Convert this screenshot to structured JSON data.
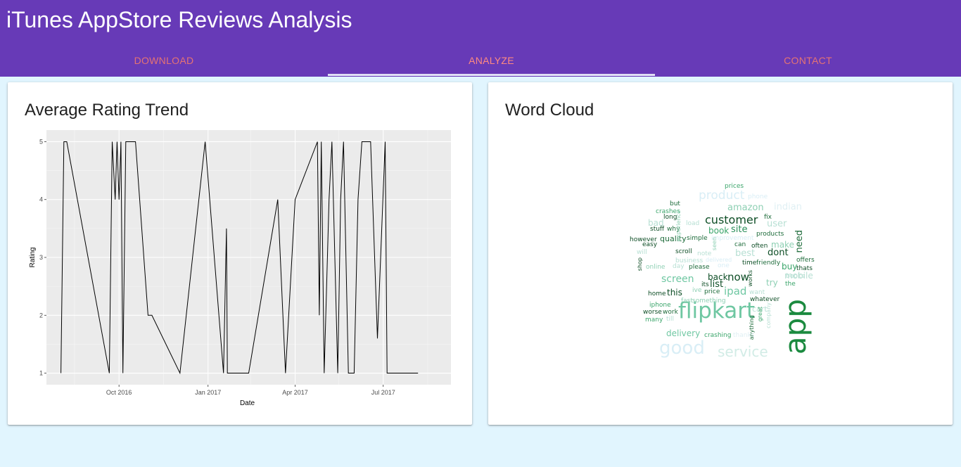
{
  "app": {
    "title": "iTunes AppStore Reviews Analysis"
  },
  "tabs": [
    {
      "label": "DOWNLOAD",
      "active": false
    },
    {
      "label": "ANALYZE",
      "active": true
    },
    {
      "label": "CONTACT",
      "active": false
    }
  ],
  "colors": {
    "appbar": "#673ab7",
    "background": "#e1f5fe",
    "tab_text": "#e57373",
    "line": "#000000",
    "panel": "#ebebeb"
  },
  "trend_card": {
    "title": "Average Rating Trend"
  },
  "wordcloud_card": {
    "title": "Word Cloud"
  },
  "chart_data": {
    "type": "line",
    "title": "",
    "xlabel": "Date",
    "ylabel": "Rating",
    "x_ticks": [
      "Oct 2016",
      "Jan 2017",
      "Apr 2017",
      "Jul 2017"
    ],
    "y_ticks": [
      1,
      2,
      3,
      4,
      5
    ],
    "ylim": [
      0.8,
      5.2
    ],
    "xlim": [
      "2016-07-18",
      "2017-09-09"
    ],
    "grid": true,
    "series": [
      {
        "x": [
          "2016-08-02",
          "2016-08-05",
          "2016-08-08",
          "2016-09-21",
          "2016-09-24",
          "2016-09-27",
          "2016-09-29",
          "2016-10-01",
          "2016-10-03",
          "2016-10-05",
          "2016-10-08",
          "2016-10-10",
          "2016-10-13",
          "2016-10-18",
          "2016-10-31",
          "2016-11-04",
          "2016-12-03",
          "2016-12-29",
          "2017-01-17",
          "2017-01-20",
          "2017-01-21",
          "2017-01-22",
          "2017-02-01",
          "2017-02-12",
          "2017-03-14",
          "2017-03-22",
          "2017-04-01",
          "2017-04-24",
          "2017-04-26",
          "2017-04-28",
          "2017-05-01",
          "2017-05-06",
          "2017-05-09",
          "2017-05-15",
          "2017-05-18",
          "2017-05-21",
          "2017-05-26",
          "2017-06-01",
          "2017-06-05",
          "2017-06-09",
          "2017-06-18",
          "2017-06-25",
          "2017-07-03",
          "2017-07-05",
          "2017-07-06",
          "2017-07-08",
          "2017-07-10",
          "2017-07-12",
          "2017-07-14",
          "2017-08-06"
        ],
        "y": [
          1,
          5,
          5,
          1,
          5,
          4,
          5,
          4,
          5,
          1,
          5,
          5,
          5,
          5,
          2,
          2,
          1,
          5,
          1,
          3.5,
          1,
          1,
          1,
          1,
          4,
          1,
          4,
          5,
          2,
          5,
          1,
          4,
          5,
          1,
          4,
          5,
          1,
          1,
          4,
          5,
          5,
          1.6,
          5,
          1,
          1,
          1,
          1,
          1,
          1,
          1
        ]
      }
    ]
  },
  "wordcloud": [
    {
      "t": "app",
      "c": "#1b8a3f",
      "r": 90
    },
    {
      "t": "flipkart",
      "c": "#6fc7a2",
      "r": 0
    },
    {
      "t": "good",
      "c": "#d9eef6",
      "r": 0
    },
    {
      "t": "service",
      "c": "#d2ece6",
      "r": 0
    },
    {
      "t": "customer",
      "c": "#0d4d25",
      "r": 0
    },
    {
      "t": "product",
      "c": "#d9eef6",
      "r": 0
    },
    {
      "t": "amazon",
      "c": "#8fd0b4",
      "r": 0
    },
    {
      "t": "indian",
      "c": "#e0f0f4",
      "r": 0
    },
    {
      "t": "user",
      "c": "#b8e0d4",
      "r": 0
    },
    {
      "t": "need",
      "c": "#1d6b3a",
      "r": 90
    },
    {
      "t": "book",
      "c": "#3aa56a",
      "r": 0
    },
    {
      "t": "site",
      "c": "#2a8f5a",
      "r": 0
    },
    {
      "t": "quality",
      "c": "#1d6b3a",
      "r": 0
    },
    {
      "t": "make",
      "c": "#8fd0b4",
      "r": 0
    },
    {
      "t": "dont",
      "c": "#0d4d25",
      "r": 0
    },
    {
      "t": "best",
      "c": "#b8e0d4",
      "r": 0
    },
    {
      "t": "buy",
      "c": "#3aa56a",
      "r": 0
    },
    {
      "t": "now",
      "c": "#0d4d25",
      "r": 0
    },
    {
      "t": "back",
      "c": "#0d4d25",
      "r": 0
    },
    {
      "t": "screen",
      "c": "#6fc7a2",
      "r": 0
    },
    {
      "t": "ipad",
      "c": "#6fc7a2",
      "r": 0
    },
    {
      "t": "list",
      "c": "#0d4d25",
      "r": 0
    },
    {
      "t": "this",
      "c": "#0d4d25",
      "r": 0
    },
    {
      "t": "mobile",
      "c": "#b8e0d4",
      "r": 0
    },
    {
      "t": "try",
      "c": "#8fd0b4",
      "r": 0
    },
    {
      "t": "delivery",
      "c": "#6fc7a2",
      "r": 0
    },
    {
      "t": "cart",
      "c": "#b8e0d4",
      "r": 0
    },
    {
      "t": "prices",
      "c": "#3aa56a",
      "r": 0
    },
    {
      "t": "phone",
      "c": "#d9eef6",
      "r": 0
    },
    {
      "t": "but",
      "c": "#1d6b3a",
      "r": 0
    },
    {
      "t": "crashes",
      "c": "#3aa56a",
      "r": 0
    },
    {
      "t": "long",
      "c": "#0d4d25",
      "r": 0
    },
    {
      "t": "bad",
      "c": "#b8e0d4",
      "r": 0
    },
    {
      "t": "stuff",
      "c": "#0d4d25",
      "r": 0
    },
    {
      "t": "why",
      "c": "#1d6b3a",
      "r": 0
    },
    {
      "t": "experience",
      "c": "#8fd0b4",
      "r": 90
    },
    {
      "t": "load",
      "c": "#b8e0d4",
      "r": 0
    },
    {
      "t": "fix",
      "c": "#1d6b3a",
      "r": 0
    },
    {
      "t": "products",
      "c": "#1d6b3a",
      "r": 0
    },
    {
      "t": "however",
      "c": "#0d4d25",
      "r": 0
    },
    {
      "t": "easy",
      "c": "#0d4d25",
      "r": 0
    },
    {
      "t": "simple",
      "c": "#1d6b3a",
      "r": 0
    },
    {
      "t": "improvement",
      "c": "#d9eef6",
      "r": 0
    },
    {
      "t": "can",
      "c": "#1d6b3a",
      "r": 0
    },
    {
      "t": "often",
      "c": "#0d4d25",
      "r": 0
    },
    {
      "t": "will",
      "c": "#b8e0d4",
      "r": 0
    },
    {
      "t": "scroll",
      "c": "#0d4d25",
      "r": 0
    },
    {
      "t": "note",
      "c": "#b8e0d4",
      "r": 0
    },
    {
      "t": "seen",
      "c": "#8fd0b4",
      "r": 90
    },
    {
      "t": "time",
      "c": "#0d4d25",
      "r": 0
    },
    {
      "t": "friendly",
      "c": "#1d6b3a",
      "r": 0
    },
    {
      "t": "shop",
      "c": "#0d4d25",
      "r": 90
    },
    {
      "t": "business",
      "c": "#b8e0d4",
      "r": 0
    },
    {
      "t": "delivered",
      "c": "#d9eef6",
      "r": 0
    },
    {
      "t": "offers",
      "c": "#1d6b3a",
      "r": 0
    },
    {
      "t": "online",
      "c": "#8fd0b4",
      "r": 0
    },
    {
      "t": "day",
      "c": "#b8e0d4",
      "r": 0
    },
    {
      "t": "please",
      "c": "#1d6b3a",
      "r": 0
    },
    {
      "t": "one",
      "c": "#d9eef6",
      "r": 0
    },
    {
      "t": "works",
      "c": "#0d4d25",
      "r": 90
    },
    {
      "t": "thats",
      "c": "#0d4d25",
      "r": 0
    },
    {
      "t": "books",
      "c": "#b8e0d4",
      "r": 0
    },
    {
      "t": "its",
      "c": "#0d4d25",
      "r": 0
    },
    {
      "t": "the",
      "c": "#3aa56a",
      "r": 0
    },
    {
      "t": "home",
      "c": "#0d4d25",
      "r": 0
    },
    {
      "t": "ive",
      "c": "#8fd0b4",
      "r": 0
    },
    {
      "t": "price",
      "c": "#1d6b3a",
      "r": 0
    },
    {
      "t": "want",
      "c": "#b8e0d4",
      "r": 0
    },
    {
      "t": "fast",
      "c": "#8fd0b4",
      "r": 0
    },
    {
      "t": "something",
      "c": "#8fd0b4",
      "r": 0
    },
    {
      "t": "whatever",
      "c": "#0d4d25",
      "r": 0
    },
    {
      "t": "iphone",
      "c": "#3aa56a",
      "r": 0
    },
    {
      "t": "worse",
      "c": "#0d4d25",
      "r": 0
    },
    {
      "t": "work",
      "c": "#1d6b3a",
      "r": 0
    },
    {
      "t": "great",
      "c": "#3aa56a",
      "r": 90
    },
    {
      "t": "company",
      "c": "#b8e0d4",
      "r": 90
    },
    {
      "t": "anything",
      "c": "#1d6b3a",
      "r": 90
    },
    {
      "t": "many",
      "c": "#3aa56a",
      "r": 0
    },
    {
      "t": "till",
      "c": "#b8e0d4",
      "r": 0
    },
    {
      "t": "crashing",
      "c": "#3aa56a",
      "r": 0
    },
    {
      "t": "thanks",
      "c": "#e0f0f4",
      "r": 0
    }
  ]
}
